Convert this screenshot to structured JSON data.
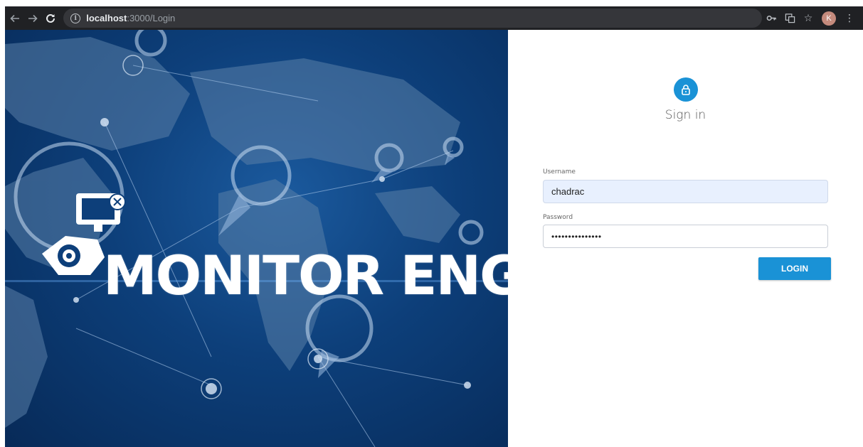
{
  "browser": {
    "url_host": "localhost",
    "url_rest": ":3000/Login",
    "avatar_letter": "K",
    "icons": [
      "back-arrow-icon",
      "forward-arrow-icon",
      "reload-icon",
      "info-icon",
      "key-icon",
      "translate-icon",
      "star-icon",
      "menu-kebab-icon"
    ]
  },
  "hero": {
    "logo_text": "MONITOR ENGINE"
  },
  "login": {
    "title": "Sign in",
    "username_label": "Username",
    "username_value": "chadrac",
    "password_label": "Password",
    "password_value": "•••••••••••••••",
    "button_label": "LOGIN"
  },
  "colors": {
    "accent": "#1a92d6",
    "chrome_bg": "#202124",
    "hero_bg": "#0d3f7a",
    "autofill_bg": "#e8f0fe"
  }
}
